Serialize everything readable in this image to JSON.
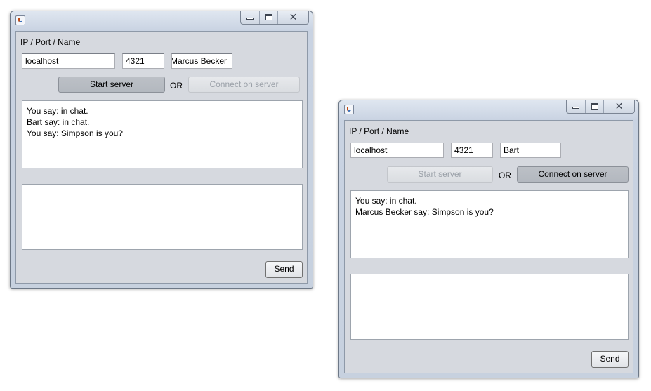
{
  "windows": [
    {
      "id": "win1",
      "label_text": "IP / Port / Name",
      "ip": "localhost",
      "port": "4321",
      "name": "Marcus Becker",
      "start_server_label": "Start server",
      "or_label": "OR",
      "connect_label": "Connect on server",
      "chat_lines": [
        "You say: in chat.",
        "Bart say: in chat.",
        "You say: Simpson is you?"
      ],
      "input_text": "",
      "send_label": "Send"
    },
    {
      "id": "win2",
      "label_text": "IP / Port / Name",
      "ip": "localhost",
      "port": "4321",
      "name": "Bart",
      "start_server_label": "Start server",
      "or_label": "OR",
      "connect_label": "Connect on server",
      "chat_lines": [
        "You say: in chat.",
        "Marcus Becker say: Simpson is you?"
      ],
      "input_text": "",
      "send_label": "Send"
    }
  ],
  "icons": {
    "app": "java-app-icon",
    "minimize": "minimize-icon",
    "maximize": "maximize-icon",
    "close": "close-icon"
  },
  "title_controls": {
    "close_glyph": "✕"
  }
}
